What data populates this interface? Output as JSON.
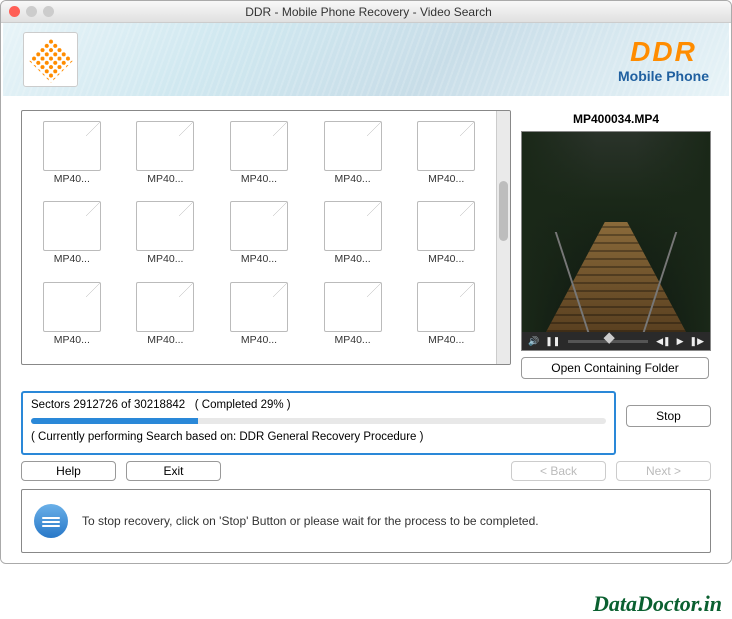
{
  "titlebar": {
    "title": "DDR - Mobile Phone Recovery - Video Search"
  },
  "brand": {
    "ddr": "DDR",
    "sub": "Mobile Phone"
  },
  "files": {
    "items": [
      {
        "label": "MP40..."
      },
      {
        "label": "MP40..."
      },
      {
        "label": "MP40..."
      },
      {
        "label": "MP40..."
      },
      {
        "label": "MP40..."
      },
      {
        "label": "MP40..."
      },
      {
        "label": "MP40..."
      },
      {
        "label": "MP40..."
      },
      {
        "label": "MP40..."
      },
      {
        "label": "MP40..."
      },
      {
        "label": "MP40..."
      },
      {
        "label": "MP40..."
      },
      {
        "label": "MP40..."
      },
      {
        "label": "MP40..."
      },
      {
        "label": "MP40..."
      }
    ]
  },
  "preview": {
    "filename": "MP400034.MP4"
  },
  "buttons": {
    "open_folder": "Open Containing Folder",
    "stop": "Stop",
    "help": "Help",
    "exit": "Exit",
    "back": "< Back",
    "next": "Next >"
  },
  "progress": {
    "sectors_label": "Sectors",
    "current": "2912726",
    "total": "30218842",
    "completed_text": "( Completed 29% )",
    "percent": 29,
    "status": "( Currently performing Search based on: DDR General Recovery Procedure )"
  },
  "hint": {
    "text": "To stop recovery, click on 'Stop' Button or please wait for the process to be completed."
  },
  "watermark": "DataDoctor.in",
  "colors": {
    "accent": "#2a88d8",
    "brand_orange": "#ff8c00",
    "brand_blue": "#2060a0"
  }
}
